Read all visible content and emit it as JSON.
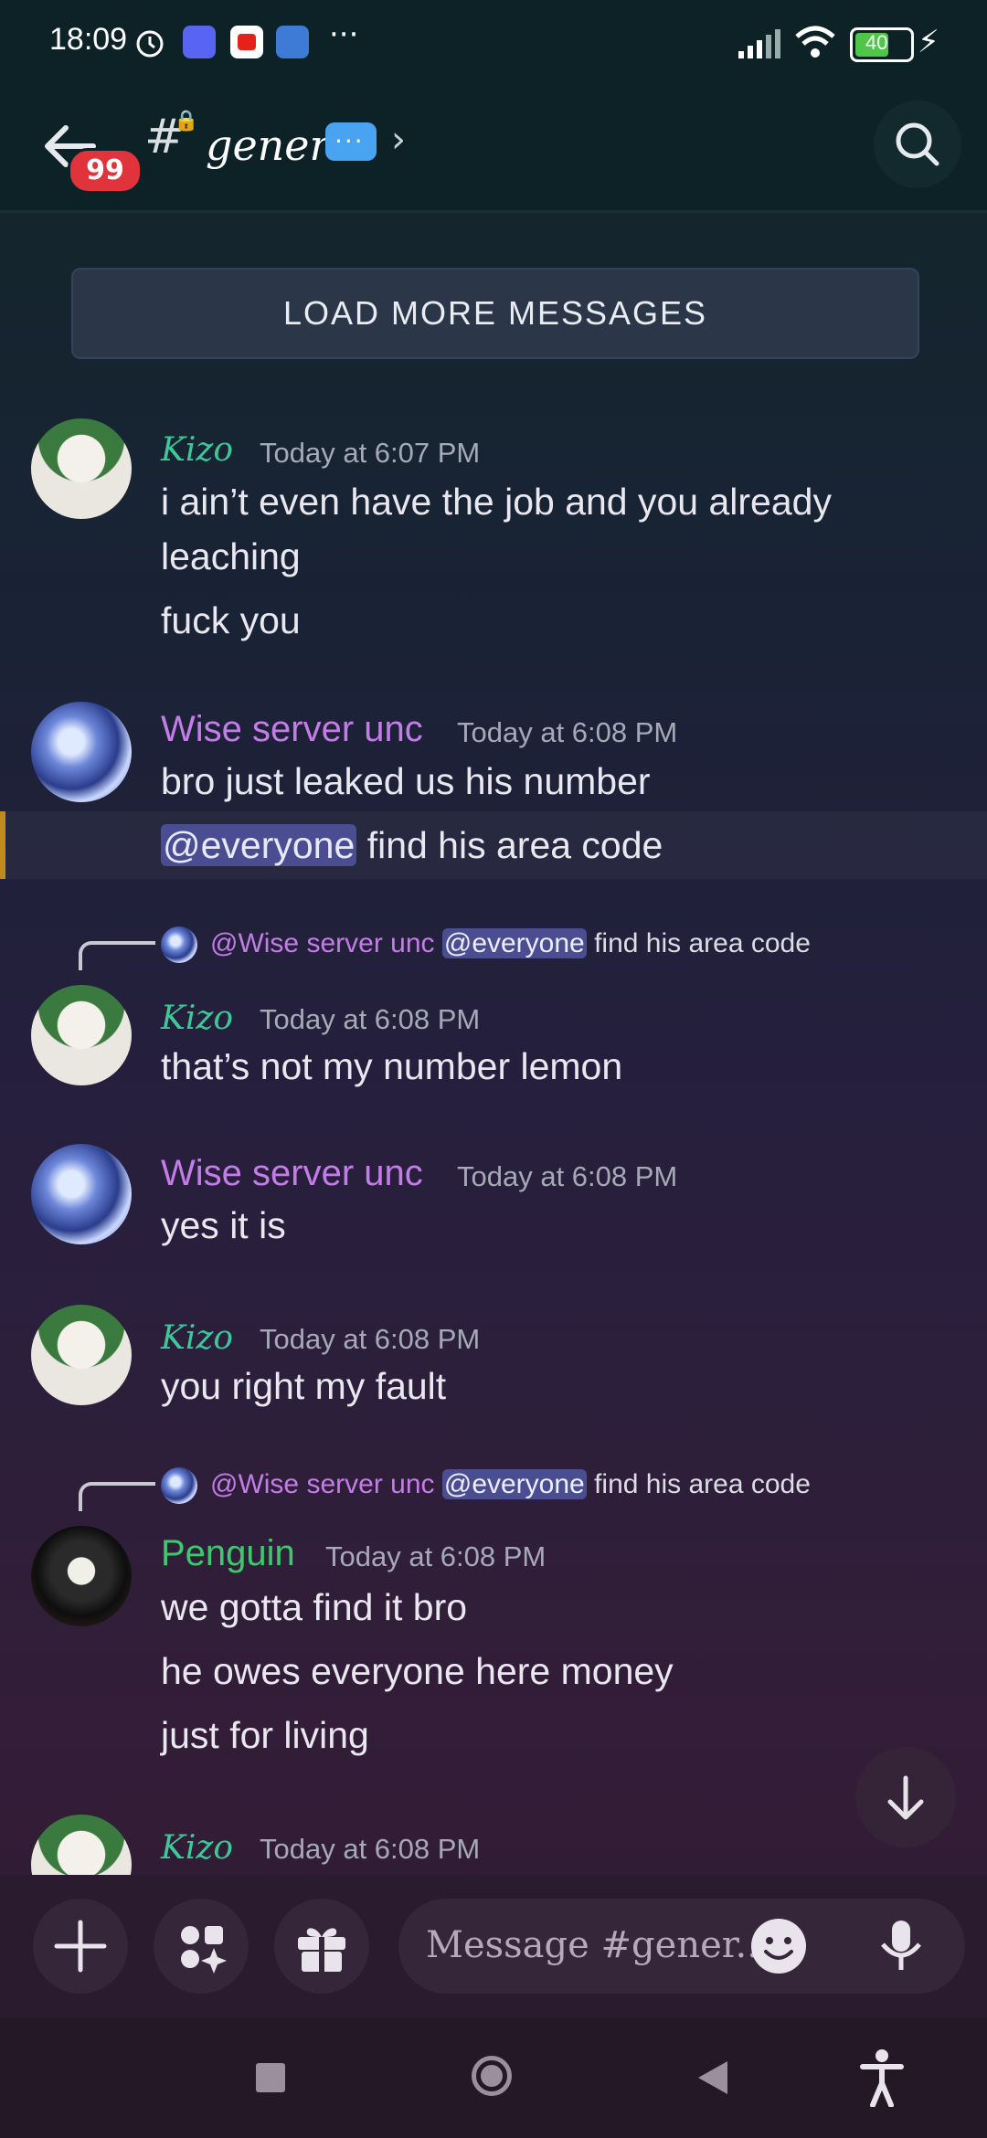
{
  "status_bar": {
    "time": "18:09",
    "battery": "40"
  },
  "header": {
    "badge": "99",
    "channel_name": "general",
    "chevron": "›"
  },
  "load_more": {
    "label": "LOAD MORE MESSAGES"
  },
  "messages": [
    {
      "author": "Kizo",
      "time": "Today at 6:07 PM",
      "lines": [
        "i ain’t even have the job and you already",
        "leaching",
        "fuck you"
      ]
    },
    {
      "author": "Wise server unc",
      "time": "Today at 6:08 PM",
      "lines": [
        "bro just leaked us his number"
      ],
      "mention": "@everyone",
      "mention_rest": " find his area code"
    },
    {
      "reply_to_name": "@Wise server unc",
      "reply_mention": "@everyone",
      "reply_text": " find his area code",
      "author": "Kizo",
      "time": "Today at 6:08 PM",
      "lines": [
        "that’s not my number lemon"
      ]
    },
    {
      "author": "Wise server unc",
      "time": "Today at 6:08 PM",
      "lines": [
        "yes it is"
      ]
    },
    {
      "author": "Kizo",
      "time": "Today at 6:08 PM",
      "lines": [
        "you right my fault"
      ]
    },
    {
      "reply_to_name": "@Wise server unc",
      "reply_mention": "@everyone",
      "reply_text": " find his area code",
      "author": "Penguin",
      "time": "Today at 6:08 PM",
      "lines": [
        "we gotta find it bro",
        "he owes everyone here money",
        "just for living"
      ]
    },
    {
      "author": "Kizo",
      "time": "Today at 6:08 PM"
    }
  ],
  "composer": {
    "placeholder": "Message #gener..."
  },
  "colors": {
    "kizo": "#3fc79a",
    "wise": "#c47ce6",
    "penguin": "#3dc96b",
    "mention_bg": "#4a4d8f",
    "unread_bar": "#c18a1c",
    "badge": "#e0333c"
  }
}
